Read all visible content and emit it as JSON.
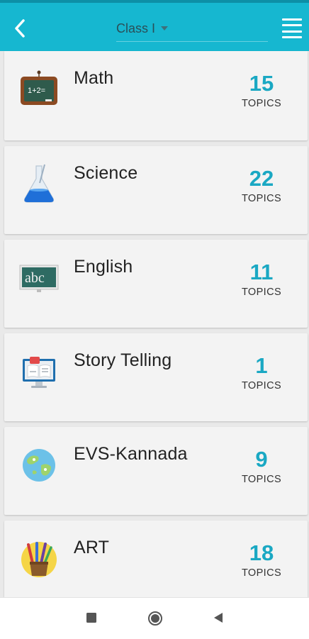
{
  "header": {
    "back_icon": "chevron-left-icon",
    "class_selector": {
      "selected": "Class I"
    },
    "menu_icon": "hamburger-menu-icon",
    "colors": {
      "bar": "#16b7d0",
      "count": "#1aa8c3"
    }
  },
  "subjects": [
    {
      "name": "Math",
      "count": "15",
      "count_label": "TOPICS",
      "icon": "chalkboard-math-icon"
    },
    {
      "name": "Science",
      "count": "22",
      "count_label": "TOPICS",
      "icon": "flask-icon"
    },
    {
      "name": "English",
      "count": "11",
      "count_label": "TOPICS",
      "icon": "abc-board-icon"
    },
    {
      "name": "Story Telling",
      "count": "1",
      "count_label": "TOPICS",
      "icon": "monitor-book-icon"
    },
    {
      "name": "EVS-Kannada",
      "count": "9",
      "count_label": "TOPICS",
      "icon": "globe-icon"
    },
    {
      "name": "ART",
      "count": "18",
      "count_label": "TOPICS",
      "icon": "paint-brushes-icon"
    }
  ],
  "system_nav": {
    "recents_icon": "square-icon",
    "home_icon": "circle-icon",
    "back_icon": "triangle-back-icon"
  }
}
